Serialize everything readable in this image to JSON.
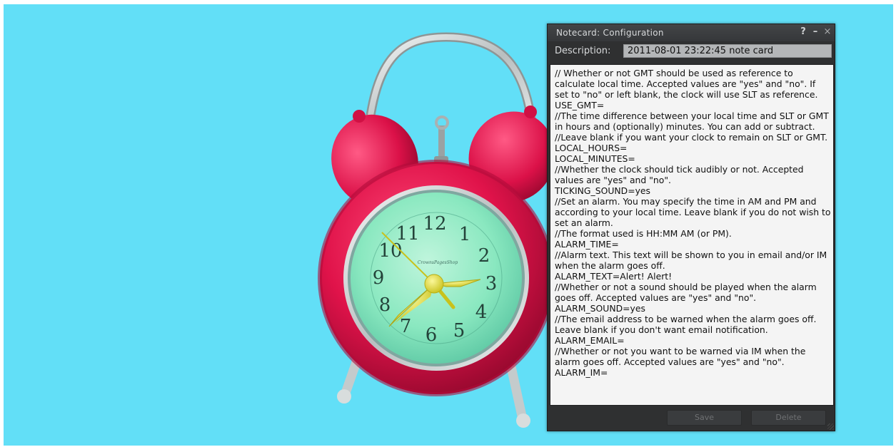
{
  "floater": {
    "title": "Notecard: Configuration",
    "help_label": "?",
    "minimize_label": "–",
    "close_label": "×",
    "description_label": "Description:",
    "description_value": "2011-08-01 23:22:45 note card",
    "notecard_text": "// Whether or not GMT should be used as reference to calculate local time. Accepted values are \"yes\" and \"no\". If set to \"no\" or left blank, the clock will use SLT as reference.\nUSE_GMT=\n//The time difference between your local time and SLT or GMT in hours and (optionally) minutes. You can add or subtract.\n//Leave blank if you want your clock to remain on SLT or GMT.\nLOCAL_HOURS=\nLOCAL_MINUTES=\n//Whether the clock should tick audibly or not. Accepted values are \"yes\" and \"no\".\nTICKING_SOUND=yes\n//Set an alarm. You may specify the time in AM and PM and according to your local time. Leave blank if you do not wish to set an alarm.\n//The format used is HH:MM AM (or PM).\nALARM_TIME=\n//Alarm text. This text will be shown to you in email and/or IM when the alarm goes off.\nALARM_TEXT=Alert! Alert!\n//Whether or not a sound should be played when the alarm goes off. Accepted values are \"yes\" and \"no\".\nALARM_SOUND=yes\n//The email address to be warned when the alarm goes off. Leave blank if you don't want email notification.\nALARM_EMAIL=\n//Whether or not you want to be warned via IM when the alarm goes off. Accepted values are \"yes\" and \"no\".\nALARM_IM=",
    "save_label": "Save",
    "delete_label": "Delete"
  },
  "clock": {
    "numerals": [
      "12",
      "1",
      "2",
      "3",
      "4",
      "5",
      "6",
      "7",
      "8",
      "9",
      "10",
      "11"
    ],
    "brand_text": "CrownsPagesShop"
  },
  "colors": {
    "sky": "#62dff7",
    "clock_red": "#e0134a",
    "dial": "#8ae8c0",
    "hands": "#e6e030"
  }
}
